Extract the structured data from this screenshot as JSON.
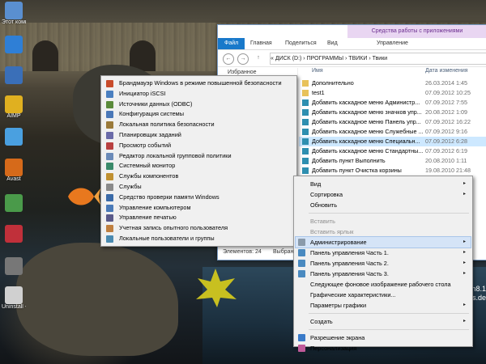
{
  "desktop": {
    "icons": [
      {
        "label": "Этот компьютер",
        "color": "#5a8fd0"
      },
      {
        "label": "",
        "color": "#2f7fd6"
      },
      {
        "label": "",
        "color": "#3a6fb8"
      },
      {
        "label": "AIMP",
        "color": "#e0b020"
      },
      {
        "label": "",
        "color": "#4aa0e0"
      },
      {
        "label": "Avast",
        "color": "#d66a1a"
      },
      {
        "label": "",
        "color": "#4a9a4a"
      },
      {
        "label": "",
        "color": "#c0303a"
      },
      {
        "label": "",
        "color": "#777777"
      },
      {
        "label": "Uninstall - Ярлык",
        "color": "#d0d0d0"
      }
    ],
    "brand_lines": [
      "n8.1",
      "s.de"
    ]
  },
  "explorer": {
    "context_tab": "Средства работы с приложениями",
    "tabs": [
      "Файл",
      "Главная",
      "Поделиться",
      "Вид",
      "Управление"
    ],
    "nav_back": "←",
    "nav_forward": "→",
    "nav_up": "↑",
    "address": "«  ДИСК (D:)  ›  ПРОГРАММЫ  ›  ТВИКИ  ›  Твики",
    "nav_pane_item": "Избранное",
    "columns": {
      "name": "Имя",
      "date": "Дата изменения"
    },
    "files": [
      {
        "name": "Дополнительно",
        "date": "26.03.2014 1:45",
        "icon": "folder"
      },
      {
        "name": "test1",
        "date": "07.09.2012 10:25",
        "icon": "folder"
      },
      {
        "name": "Добавить каскадное меню Администр...",
        "date": "07.09.2012 7:55",
        "icon": "reg"
      },
      {
        "name": "Добавить каскадное меню значков упр...",
        "date": "20.08.2012 1:09",
        "icon": "reg"
      },
      {
        "name": "Добавить каскадное меню Панель упр...",
        "date": "07.09.2012 16:22",
        "icon": "reg"
      },
      {
        "name": "Добавить каскадное меню Служебные ...",
        "date": "07.09.2012 9:16",
        "icon": "reg"
      },
      {
        "name": "Добавить каскадное меню Специальн...",
        "date": "07.09.2012 6:28",
        "icon": "reg"
      },
      {
        "name": "Добавить каскадное меню Стандартны...",
        "date": "07.09.2012 6:19",
        "icon": "reg"
      },
      {
        "name": "Добавить пункт Выполнить",
        "date": "20.08.2010 1:11",
        "icon": "reg"
      },
      {
        "name": "Добавить пункт Очистка корзины",
        "date": "19.08.2010 21:48",
        "icon": "reg"
      }
    ],
    "selected_index": 6,
    "status_count": "Элементов: 24",
    "status_selected": "Выбран"
  },
  "admin_menu": {
    "items": [
      {
        "label": "Брандмауэр Windows в режиме повышенной безопасности",
        "icon": "firewall-icon",
        "color": "#c84b2a"
      },
      {
        "label": "Инициатор iSCSI",
        "icon": "iscsi-icon",
        "color": "#4a7fc0"
      },
      {
        "label": "Источники данных (ODBC)",
        "icon": "odbc-icon",
        "color": "#5a8a3a"
      },
      {
        "label": "Конфигурация системы",
        "icon": "msconfig-icon",
        "color": "#4a78b8"
      },
      {
        "label": "Локальная политика безопасности",
        "icon": "policy-icon",
        "color": "#9a7a3a"
      },
      {
        "label": "Планировщик заданий",
        "icon": "scheduler-icon",
        "color": "#6a6aa8"
      },
      {
        "label": "Просмотр событий",
        "icon": "event-viewer-icon",
        "color": "#b84040"
      },
      {
        "label": "Редактор локальной групповой политики",
        "icon": "gpedit-icon",
        "color": "#6a8ab8"
      },
      {
        "label": "Системный монитор",
        "icon": "monitor-icon",
        "color": "#3a8a6a"
      },
      {
        "label": "Службы компонентов",
        "icon": "components-icon",
        "color": "#c09030"
      },
      {
        "label": "Службы",
        "icon": "services-icon",
        "color": "#8a8a8a"
      },
      {
        "label": "Средство проверки памяти Windows",
        "icon": "memory-icon",
        "color": "#3a6aa8"
      },
      {
        "label": "Управление компьютером",
        "icon": "computer-mgmt-icon",
        "color": "#4a7ab8"
      },
      {
        "label": "Управление печатью",
        "icon": "print-icon",
        "color": "#5a5a8a"
      },
      {
        "label": "Учетная запись опытного пользователя",
        "icon": "user-icon",
        "color": "#c08040"
      },
      {
        "label": "Локальные пользователи и группы",
        "icon": "users-icon",
        "color": "#4a8ab0"
      }
    ]
  },
  "context_menu": {
    "items": [
      {
        "label": "Вид",
        "submenu": true,
        "disabled": false,
        "icon": ""
      },
      {
        "label": "Сортировка",
        "submenu": true,
        "disabled": false,
        "icon": ""
      },
      {
        "label": "Обновить",
        "submenu": false,
        "disabled": false,
        "icon": ""
      },
      {
        "sep": true
      },
      {
        "label": "Вставить",
        "submenu": false,
        "disabled": true,
        "icon": ""
      },
      {
        "label": "Вставить ярлык",
        "submenu": false,
        "disabled": true,
        "icon": ""
      },
      {
        "label": "Администрирование",
        "submenu": true,
        "disabled": false,
        "icon": "admin-tools-icon",
        "highlight": true
      },
      {
        "label": "Панель управления Часть 1.",
        "submenu": true,
        "disabled": false,
        "icon": "control-panel-icon"
      },
      {
        "label": "Панель управления Часть 2.",
        "submenu": true,
        "disabled": false,
        "icon": "control-panel-icon"
      },
      {
        "label": "Панель управления Часть 3.",
        "submenu": true,
        "disabled": false,
        "icon": "control-panel-icon"
      },
      {
        "label": "Следующее фоновое изображение рабочего стола",
        "submenu": false,
        "disabled": false,
        "icon": ""
      },
      {
        "label": "Графические характеристики...",
        "submenu": false,
        "disabled": false,
        "icon": ""
      },
      {
        "label": "Параметры графики",
        "submenu": true,
        "disabled": false,
        "icon": ""
      },
      {
        "sep": true
      },
      {
        "label": "Создать",
        "submenu": true,
        "disabled": false,
        "icon": ""
      },
      {
        "sep": true
      },
      {
        "label": "Разрешение экрана",
        "submenu": false,
        "disabled": false,
        "icon": "display-icon"
      },
      {
        "label": "Персонализация",
        "submenu": false,
        "disabled": false,
        "icon": "personalize-icon"
      }
    ],
    "arrow": "▸"
  }
}
